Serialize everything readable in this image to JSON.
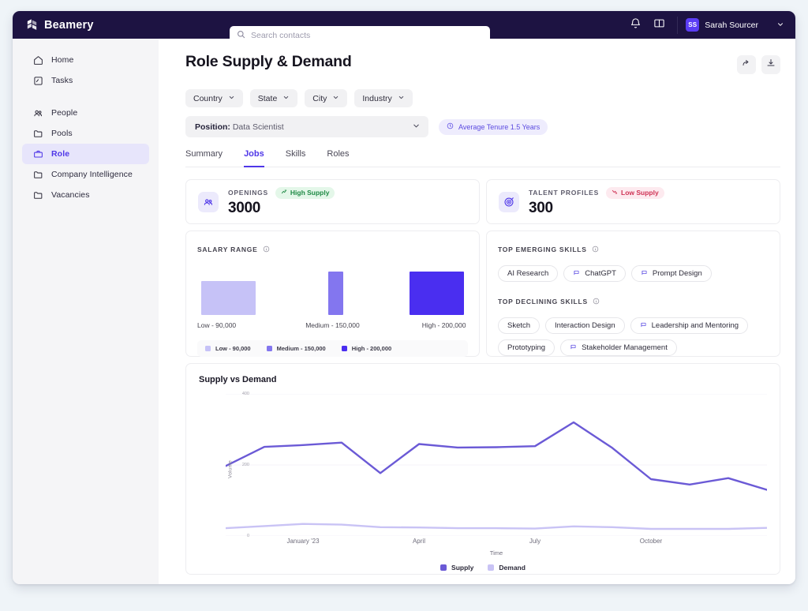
{
  "brand": {
    "name": "Beamery",
    "logo_icon": "beamery-logo-icon"
  },
  "search": {
    "placeholder": "Search contacts",
    "value": "",
    "icon": "search-icon"
  },
  "topbar": {
    "notifications_icon": "bell-icon",
    "guide_icon": "book-icon",
    "user_initials": "SS",
    "user_name": "Sarah Sourcer",
    "caret_icon": "chevron-down-icon"
  },
  "sidebar": {
    "items": [
      {
        "label": "Home",
        "icon": "home-icon",
        "active": false
      },
      {
        "label": "Tasks",
        "icon": "tasks-icon",
        "active": false
      },
      {
        "label": "People",
        "icon": "people-icon",
        "active": false
      },
      {
        "label": "Pools",
        "icon": "folder-icon",
        "active": false
      },
      {
        "label": "Role",
        "icon": "briefcase-icon",
        "active": true
      },
      {
        "label": "Company Intelligence",
        "icon": "folder-icon",
        "active": false
      },
      {
        "label": "Vacancies",
        "icon": "folder-icon",
        "active": false
      }
    ]
  },
  "header": {
    "title": "Role Supply & Demand",
    "share_icon": "share-arrow-icon",
    "download_icon": "download-icon"
  },
  "filters": {
    "pills": [
      {
        "label": "Country",
        "icon": "chevron-down-icon"
      },
      {
        "label": "State",
        "icon": "chevron-down-icon"
      },
      {
        "label": "City",
        "icon": "chevron-down-icon"
      },
      {
        "label": "Industry",
        "icon": "chevron-down-icon"
      }
    ],
    "position_label": "Position:",
    "position_value": "Data Scientist",
    "tenure_chip": "Average Tenure 1.5 Years",
    "tenure_icon": "clock-icon"
  },
  "tabs": [
    {
      "label": "Summary",
      "active": false
    },
    {
      "label": "Jobs",
      "active": true
    },
    {
      "label": "Skills",
      "active": false
    },
    {
      "label": "Roles",
      "active": false
    }
  ],
  "stats": [
    {
      "label": "OPENINGS",
      "value": "3000",
      "badge": "High Supply",
      "badge_type": "high",
      "icon": "people-group-icon",
      "badge_icon": "trend-up-icon"
    },
    {
      "label": "TALENT PROFILES",
      "value": "300",
      "badge": "Low Supply",
      "badge_type": "low",
      "icon": "target-icon",
      "badge_icon": "trend-down-icon"
    }
  ],
  "salary": {
    "title": "SALARY RANGE",
    "info_icon": "info-icon",
    "ticks": [
      {
        "label": "Low - 90,000",
        "pct": 0
      },
      {
        "label": "Medium - 150,000",
        "pct": 40
      },
      {
        "label": "High - 200,000",
        "pct": 83
      }
    ],
    "legend": [
      {
        "label": "Low - 90,000",
        "color": "#c6c2f7"
      },
      {
        "label": "Medium - 150,000",
        "color": "#8376ef"
      },
      {
        "label": "High - 200,000",
        "color": "#4a2ef0"
      }
    ],
    "chart_data": {
      "type": "bar",
      "title": "Salary Range",
      "categories": [
        "Low - 90,000",
        "Medium - 150,000",
        "High - 200,000"
      ],
      "values": [
        90000,
        150000,
        200000
      ],
      "colors": [
        "#c6c2f7",
        "#8376ef",
        "#4a2ef0"
      ],
      "bar_left_pct": [
        1.5,
        48.5,
        78.5
      ],
      "bar_width_pct": [
        20,
        5.5,
        20
      ],
      "bar_height_pct": [
        78,
        100,
        100
      ],
      "xlabel": "",
      "ylabel": "",
      "grid": false,
      "legend_position": "bottom"
    }
  },
  "skills": {
    "emerging_title": "TOP EMERGING SKILLS",
    "declining_title": "TOP DECLINING SKILLS",
    "info_icon": "info-icon",
    "emerging": [
      {
        "label": "AI Research",
        "tag": false
      },
      {
        "label": "ChatGPT",
        "tag": true
      },
      {
        "label": "Prompt Design",
        "tag": true
      }
    ],
    "declining": [
      {
        "label": "Sketch",
        "tag": false
      },
      {
        "label": "Interaction Design",
        "tag": false
      },
      {
        "label": "Leadership and Mentoring",
        "tag": true
      },
      {
        "label": "Prototyping",
        "tag": false
      },
      {
        "label": "Stakeholder Management",
        "tag": true
      }
    ]
  },
  "supply_demand": {
    "title": "Supply vs Demand",
    "legend": [
      {
        "label": "Supply",
        "color": "#6b5ad6"
      },
      {
        "label": "Demand",
        "color": "#c9c3f5"
      }
    ]
  },
  "chart_data": {
    "type": "line",
    "title": "Supply vs Demand",
    "xlabel": "Time",
    "ylabel": "Volume",
    "ylim": [
      0,
      400
    ],
    "yticks": [
      0,
      200,
      400
    ],
    "ytick_labels": [
      "0",
      "200",
      "400"
    ],
    "grid": false,
    "legend_position": "bottom",
    "x": [
      1,
      2,
      3,
      4,
      5,
      6,
      7,
      8,
      9,
      10,
      11,
      12,
      13,
      14,
      15
    ],
    "xtick_positions": [
      2,
      5,
      8,
      11
    ],
    "xtick_labels": [
      "January '23",
      "April",
      "July",
      "October"
    ],
    "series": [
      {
        "name": "Supply",
        "color": "#6b5ad6",
        "values": [
          197,
          251,
          256,
          263,
          177,
          259,
          249,
          250,
          253,
          320,
          248,
          160,
          145,
          163,
          130
        ]
      },
      {
        "name": "Demand",
        "color": "#c9c3f5",
        "values": [
          22,
          28,
          34,
          32,
          25,
          24,
          22,
          22,
          21,
          27,
          25,
          20,
          20,
          20,
          23
        ]
      }
    ]
  }
}
